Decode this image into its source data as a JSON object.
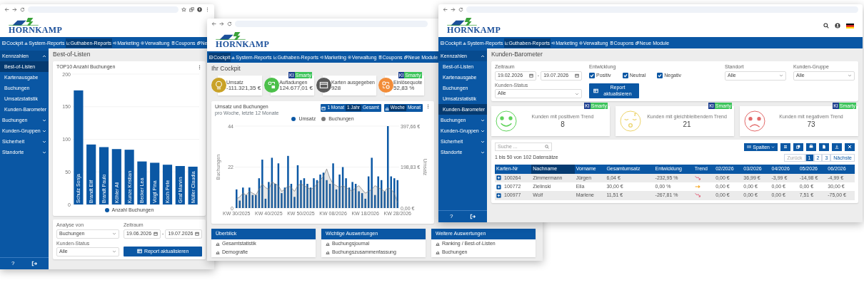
{
  "windows": [
    {
      "kind": "best_of",
      "browser_actions": true,
      "logo": "HORNKAMP",
      "nav": [
        {
          "label": "Cockpit",
          "selected": false
        },
        {
          "label": "System-Reports",
          "selected": false
        },
        {
          "label": "Guthaben-Reports",
          "selected": true
        },
        {
          "label": "Marketing",
          "selected": false
        },
        {
          "label": "Verwaltung",
          "selected": false
        },
        {
          "label": "Coupons",
          "selected": false
        },
        {
          "label": "Ne",
          "selected": false
        }
      ],
      "sidebar": {
        "groups": [
          {
            "label": "Kennzahlen",
            "expanded": true,
            "children": [
              {
                "label": "Best-of-Listen",
                "selected": true
              },
              {
                "label": "Kartenausgabe",
                "selected": false
              },
              {
                "label": "Buchungen",
                "selected": false
              },
              {
                "label": "Umsatzstatistik",
                "selected": false
              },
              {
                "label": "Kunden-Barometer",
                "selected": false
              }
            ]
          },
          {
            "label": "Buchungen",
            "expanded": false
          },
          {
            "label": "Kunden-Gruppen",
            "expanded": false
          },
          {
            "label": "Sicherheit",
            "expanded": false
          },
          {
            "label": "Standorte",
            "expanded": false
          }
        ],
        "help": "?"
      },
      "page_title": "Best-of-Listen",
      "chart_card": {
        "chart_data": {
          "type": "bar",
          "title": "TOP10 Anzahl Buchungen",
          "categories": [
            "Schulz Sonja",
            "Brandt Elif",
            "Brandt Paulo",
            "Köhler Ali",
            "Kunze Kristian",
            "Becker Lea",
            "Voigt Pina",
            "Koch Pete",
            "Graf Marvin",
            "Müller Claudia"
          ],
          "series": [
            {
              "name": "Anzahl Buchungen",
              "color": "#0a57a4",
              "values": [
                175,
                92,
                88,
                85,
                84,
                66,
                64,
                61,
                59,
                58
              ]
            }
          ],
          "yticks": [
            0,
            50,
            100,
            150,
            200
          ],
          "ylim": [
            0,
            200
          ],
          "grid": true,
          "legend": true
        }
      },
      "filters": [
        {
          "kind": "select",
          "label": "Analyse von",
          "value": "Buchungen"
        },
        {
          "kind": "daterange",
          "label": "Zeitraum",
          "from": "19.06.2026",
          "separator": "-",
          "to": "19.07.2026"
        },
        {
          "kind": "select",
          "label": "Kunden-Status",
          "value": "Alle"
        }
      ],
      "button": "Report aktualisieren"
    },
    {
      "kind": "cockpit",
      "logo": "HORNKAMP",
      "nav": [
        {
          "label": "Cockpit",
          "selected": true
        },
        {
          "label": "System-Reports",
          "selected": false
        },
        {
          "label": "Guthaben-Reports",
          "selected": false
        },
        {
          "label": "Marketing",
          "selected": false
        },
        {
          "label": "Verwaltung",
          "selected": false
        },
        {
          "label": "Coupons",
          "selected": false
        },
        {
          "label": "Neue Module",
          "selected": false
        }
      ],
      "page_title": "Ihr Cockpit",
      "kpis": [
        {
          "kind": "revenue",
          "color": "#c9a227",
          "label": "Umsatz",
          "value": "-111.321,35 €"
        },
        {
          "kind": "topup",
          "color": "#4cc04a",
          "label": "Aufladungen",
          "value": "124.677,01 €",
          "badge": [
            "KI",
            "Smarty"
          ]
        },
        {
          "kind": "cards",
          "color": "#5a5a5a",
          "label": "Karten ausgegeben",
          "value": "928"
        },
        {
          "kind": "rate",
          "color": "#f28c38",
          "label": "Einlösequote",
          "value": "52,83 %",
          "badge": [
            "KI",
            "Smarty"
          ]
        }
      ],
      "chart_card": {
        "subtitle": "pro Woche, letzte 12 Monate",
        "ranges": [
          {
            "label": "1 Monat",
            "selected": false
          },
          {
            "label": "1 Jahr",
            "selected": true
          },
          {
            "label": "Gesamt",
            "selected": false
          }
        ],
        "granularity": [
          {
            "label": "Woche",
            "selected": true
          },
          {
            "label": "Monat",
            "selected": false
          }
        ],
        "chart_data": {
          "type": "bar",
          "title": "Umsatz und Buchungen",
          "grid": true,
          "legend": true,
          "ylabel": "Buchungen",
          "y2label": "Umsatz",
          "ylim": [
            0,
            44
          ],
          "yticks": [
            0,
            22,
            44
          ],
          "y2lim": [
            0,
            397.66
          ],
          "y2ticks": [
            {
              "value": 0,
              "label": "0,00 €"
            },
            {
              "value": 198.83,
              "label": "198,83 €"
            },
            {
              "value": 397.66,
              "label": "397,66 €"
            }
          ],
          "categories": [
            "KW 30/2025",
            null,
            null,
            null,
            null,
            null,
            null,
            null,
            null,
            null,
            "KW 40/2025",
            null,
            null,
            null,
            null,
            null,
            null,
            null,
            null,
            null,
            "KW 50/2025",
            null,
            null,
            null,
            null,
            null,
            null,
            null,
            null,
            null,
            "KW 08/2026",
            null,
            null,
            null,
            null,
            null,
            null,
            null,
            null,
            null,
            "KW 18/2026",
            null,
            null,
            null,
            null,
            null,
            null,
            null,
            null,
            null,
            "KW 28/2026"
          ],
          "series": [
            {
              "name": "Umsatz",
              "type": "bar",
              "color": "#0a57a4",
              "values": [
                10,
                4,
                11,
                7,
                11,
                7,
                7,
                16,
                26,
                5,
                14,
                27,
                13,
                24,
                8,
                11,
                28,
                13,
                6,
                23,
                15,
                16,
                13,
                11,
                16,
                15,
                18,
                19,
                15,
                13,
                24,
                10,
                18,
                22,
                16,
                11,
                14,
                13,
                9,
                8,
                5,
                17,
                27,
                7,
                17,
                15,
                9,
                44,
                17,
                16,
                15
              ]
            },
            {
              "name": "Buchungen",
              "type": "area",
              "color": "#777777",
              "values": [
                5,
                6,
                8,
                7,
                9,
                8,
                7,
                10,
                13,
                11,
                10,
                14,
                13,
                12,
                9,
                10,
                12,
                11,
                9,
                12,
                13,
                12,
                11,
                10,
                11,
                13,
                15,
                17,
                21,
                16,
                13,
                12,
                11,
                12,
                11,
                10,
                9,
                11,
                12,
                10,
                8,
                9,
                10,
                12,
                11,
                10,
                9,
                11,
                10,
                8,
                3
              ]
            }
          ]
        }
      },
      "panels": [
        {
          "title": "Überblick",
          "items": [
            "Gesamtstatistik",
            "Demografie"
          ]
        },
        {
          "title": "Wichtige Auswertungen",
          "items": [
            "Buchungsjournal",
            "Buchungszusammenfassung"
          ]
        },
        {
          "title": "Weitere Auswertungen",
          "items": [
            "Ranking / Best-of-Listen",
            "Buchungen"
          ]
        }
      ]
    },
    {
      "kind": "barometer",
      "header_icons": true,
      "logo": "HORNKAMP",
      "nav": [
        {
          "label": "Cockpit",
          "selected": false
        },
        {
          "label": "System-Reports",
          "selected": false
        },
        {
          "label": "Guthaben-Reports",
          "selected": true
        },
        {
          "label": "Marketing",
          "selected": false
        },
        {
          "label": "Verwaltung",
          "selected": false
        },
        {
          "label": "Coupons",
          "selected": false
        },
        {
          "label": "Neue Module",
          "selected": false
        }
      ],
      "sidebar": {
        "groups": [
          {
            "label": "Kennzahlen",
            "expanded": true,
            "children": [
              {
                "label": "Best-of-Listen",
                "selected": false
              },
              {
                "label": "Kartenausgabe",
                "selected": false
              },
              {
                "label": "Buchungen",
                "selected": false
              },
              {
                "label": "Umsatzstatistik",
                "selected": false
              },
              {
                "label": "Kunden-Barometer",
                "selected": true
              }
            ]
          },
          {
            "label": "Buchungen",
            "expanded": false
          },
          {
            "label": "Kunden-Gruppen",
            "expanded": false
          },
          {
            "label": "Sicherheit",
            "expanded": false
          },
          {
            "label": "Standorte",
            "expanded": false
          }
        ],
        "help": "?"
      },
      "page_title": "Kunden-Barometer",
      "filters": [
        {
          "kind": "daterange",
          "label": "Zeitraum",
          "from": "19.02.2026",
          "separator": "-",
          "to": "19.07.2026"
        },
        {
          "kind": "checks",
          "label": "Entwicklung",
          "options": [
            {
              "label": "Positiv",
              "checked": true
            },
            {
              "label": "Neutral",
              "checked": true
            },
            {
              "label": "Negativ",
              "checked": true
            }
          ]
        },
        {
          "kind": "select",
          "label": "Standort",
          "value": "Alle"
        },
        {
          "kind": "select",
          "label": "Kunden-Gruppe",
          "value": "Alle"
        },
        {
          "kind": "select",
          "label": "Kunden-Status",
          "value": "Alle"
        }
      ],
      "button": "Report aktualisieren",
      "trend_cards": [
        {
          "kind": "positive",
          "color": "#5fd35a",
          "label": "Kunden mit positivem Trend",
          "value": "8",
          "badge": [
            "KI",
            "Smarty"
          ]
        },
        {
          "kind": "neutral",
          "color": "#ecd36a",
          "label": "Kunden mit gleichbleibendem Trend",
          "value": "21",
          "badge": [
            "KI",
            "Smarty"
          ]
        },
        {
          "kind": "negative",
          "color": "#e26a6a",
          "label": "Kunden mit negativem Trend",
          "value": "73",
          "badge": [
            "KI",
            "Smarty"
          ]
        }
      ],
      "table": {
        "search_placeholder": "Suche ...",
        "info": "1 bis 50 von 102 Datensätze",
        "columns_button": "Spalten",
        "pages": [
          {
            "label": "Zurück",
            "selected": false,
            "disabled": true
          },
          {
            "label": "1",
            "selected": true,
            "disabled": false
          },
          {
            "label": "2",
            "selected": false,
            "disabled": false
          },
          {
            "label": "3",
            "selected": false,
            "disabled": false
          },
          {
            "label": "Nächste",
            "selected": false,
            "disabled": false
          }
        ],
        "columns": [
          {
            "label": "Karten-Nr",
            "kind": "text",
            "sorted": false
          },
          {
            "label": "Nachname",
            "kind": "text",
            "sorted": true
          },
          {
            "label": "Vorname",
            "kind": "text",
            "sorted": false
          },
          {
            "label": "Gesamtumsatz",
            "kind": "text",
            "sorted": false
          },
          {
            "label": "Entwicklung",
            "kind": "text",
            "sorted": false
          },
          {
            "label": "Trend",
            "kind": "trend",
            "sorted": false
          },
          {
            "label": "02/2026",
            "kind": "text",
            "sorted": false
          },
          {
            "label": "03/2026",
            "kind": "text",
            "sorted": false
          },
          {
            "label": "04/2026",
            "kind": "text",
            "sorted": false
          },
          {
            "label": "05/2026",
            "kind": "text",
            "sorted": false
          },
          {
            "label": "06/2026",
            "kind": "text",
            "sorted": false
          }
        ],
        "rows": [
          {
            "kind": "falling",
            "cells": [
              "100264",
              "Zimmermann",
              "Jürgen",
              "6,04 €",
              "-232,95 %",
              "",
              "0,00 €",
              "36,99 €",
              "-3,99 €",
              "-14,98 €",
              "-4,99 €"
            ]
          },
          {
            "kind": "steady",
            "cells": [
              "100772",
              "Zielinski",
              "Ella",
              "30,00 €",
              "0,00 %",
              "",
              "0,00 €",
              "0,00 €",
              "0,00 €",
              "0,00 €",
              "30,00 €"
            ]
          },
          {
            "kind": "falling",
            "cells": [
              "100977",
              "Wolf",
              "Marlene",
              "11,51 €",
              "-267,81 %",
              "",
              "0,00 €",
              "0,00 €",
              "0,00 €",
              "7,51 €",
              "-75,00 €"
            ]
          }
        ]
      }
    }
  ]
}
